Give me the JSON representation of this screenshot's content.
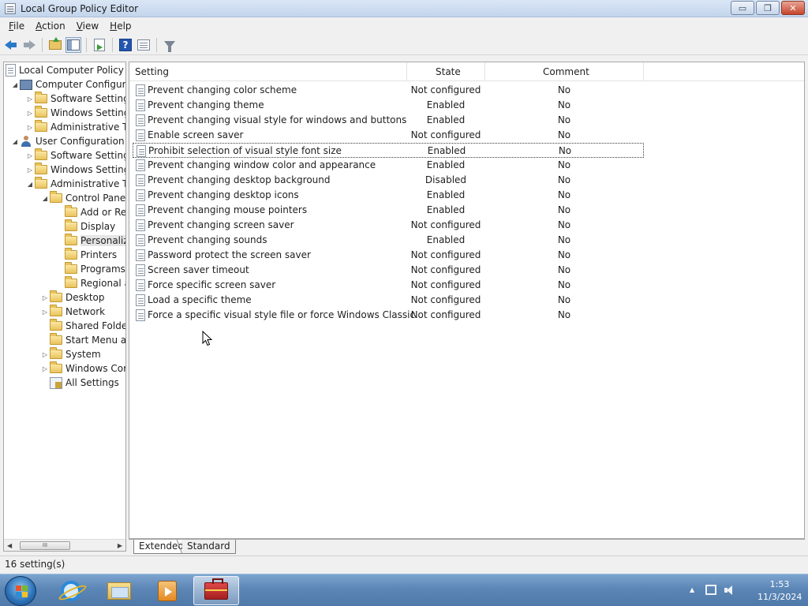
{
  "window": {
    "title": "Local Group Policy Editor",
    "buttons": {
      "minimize": "▭",
      "maximize": "❐",
      "close": "✕"
    }
  },
  "menu": [
    {
      "label": "File",
      "mnemonic": "F",
      "rest": "ile"
    },
    {
      "label": "Action",
      "mnemonic": "A",
      "rest": "ction"
    },
    {
      "label": "View",
      "mnemonic": "V",
      "rest": "iew"
    },
    {
      "label": "Help",
      "mnemonic": "H",
      "rest": "elp"
    }
  ],
  "toolbar": {
    "icons": [
      "back-arrow-icon",
      "forward-arrow-icon",
      "up-one-level-icon",
      "show-hide-console-tree-icon",
      "export-list-icon",
      "help-icon",
      "properties-icon",
      "filter-icon"
    ],
    "help_glyph": "?"
  },
  "tree": {
    "root": "Local Computer Policy",
    "computer_config": "Computer Configura",
    "cc_software": "Software Settings",
    "cc_windows": "Windows Setting",
    "cc_admin": "Administrative Te",
    "user_config": "User Configuration",
    "uc_software": "Software Settings",
    "uc_windows": "Windows Setting",
    "uc_admin": "Administrative Te",
    "control_panel": "Control Panel",
    "add_remove": "Add or Re",
    "display": "Display",
    "personalization": "Personaliz",
    "printers": "Printers",
    "programs": "Programs",
    "regional": "Regional a",
    "desktop": "Desktop",
    "network": "Network",
    "shared_folders": "Shared Folder",
    "start_menu": "Start Menu ar",
    "system": "System",
    "windows_components": "Windows Cor",
    "all_settings": "All Settings",
    "expanded_glyph": "◢",
    "collapsed_glyph": "▷"
  },
  "scrollbar": {
    "left_arrow": "◀",
    "right_arrow": "▶",
    "thumb_grip": "III"
  },
  "columns": {
    "setting": "Setting",
    "state": "State",
    "comment": "Comment"
  },
  "settings": [
    {
      "setting": "Prevent changing color scheme",
      "state": "Not configured",
      "comment": "No"
    },
    {
      "setting": "Prevent changing theme",
      "state": "Enabled",
      "comment": "No"
    },
    {
      "setting": "Prevent changing visual style for windows and buttons",
      "state": "Enabled",
      "comment": "No"
    },
    {
      "setting": "Enable screen saver",
      "state": "Not configured",
      "comment": "No"
    },
    {
      "setting": "Prohibit selection of visual style font size",
      "state": "Enabled",
      "comment": "No"
    },
    {
      "setting": "Prevent changing window color and appearance",
      "state": "Enabled",
      "comment": "No"
    },
    {
      "setting": "Prevent changing desktop background",
      "state": "Disabled",
      "comment": "No"
    },
    {
      "setting": "Prevent changing desktop icons",
      "state": "Enabled",
      "comment": "No"
    },
    {
      "setting": "Prevent changing mouse pointers",
      "state": "Enabled",
      "comment": "No"
    },
    {
      "setting": "Prevent changing screen saver",
      "state": "Not configured",
      "comment": "No"
    },
    {
      "setting": "Prevent changing sounds",
      "state": "Enabled",
      "comment": "No"
    },
    {
      "setting": "Password protect the screen saver",
      "state": "Not configured",
      "comment": "No"
    },
    {
      "setting": "Screen saver timeout",
      "state": "Not configured",
      "comment": "No"
    },
    {
      "setting": "Force specific screen saver",
      "state": "Not configured",
      "comment": "No"
    },
    {
      "setting": "Load a specific theme",
      "state": "Not configured",
      "comment": "No"
    },
    {
      "setting": "Force a specific visual style file or force Windows Classic",
      "state": "Not configured",
      "comment": "No"
    }
  ],
  "tabs": {
    "extended": "Extended",
    "standard": "Standard"
  },
  "status": {
    "text": "16 setting(s)"
  },
  "taskbar": {
    "apps": [
      "internet-explorer-icon",
      "windows-explorer-icon",
      "media-player-icon",
      "group-policy-editor-icon"
    ],
    "tray_arrow": "▲",
    "time": "1:53",
    "date": "11/3/2024"
  },
  "colors": {
    "selected_tree_item": "#e5e5e5",
    "taskbar": "#5c86b6",
    "close_button": "#c7452b"
  }
}
